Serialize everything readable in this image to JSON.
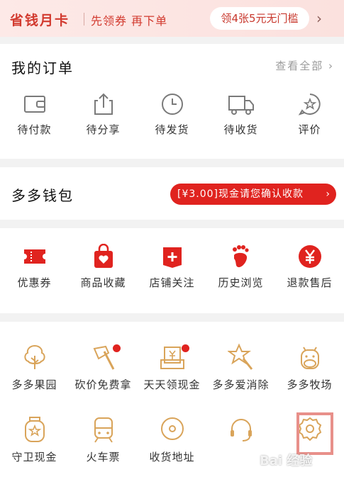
{
  "banner": {
    "title": "省钱月卡",
    "subtitle": "先领券 再下单",
    "pill": "领4张5元无门槛",
    "chevron": "›"
  },
  "orders": {
    "title": "我的订单",
    "view_all": "查看全部 ›",
    "items": [
      {
        "label": "待付款",
        "icon": "wallet-icon"
      },
      {
        "label": "待分享",
        "icon": "share-icon"
      },
      {
        "label": "待发货",
        "icon": "clock-icon"
      },
      {
        "label": "待收货",
        "icon": "truck-icon"
      },
      {
        "label": "评价",
        "icon": "review-icon"
      }
    ]
  },
  "wallet": {
    "title": "多多钱包",
    "notice": "[¥3.00]现金请您确认收款",
    "arrow": "›"
  },
  "services": {
    "items": [
      {
        "label": "优惠券",
        "icon": "coupon-icon"
      },
      {
        "label": "商品收藏",
        "icon": "bag-heart-icon"
      },
      {
        "label": "店铺关注",
        "icon": "store-plus-icon"
      },
      {
        "label": "历史浏览",
        "icon": "footprint-icon"
      },
      {
        "label": "退款售后",
        "icon": "yen-circle-icon"
      }
    ]
  },
  "tools": {
    "items": [
      {
        "label": "多多果园",
        "icon": "tree-icon"
      },
      {
        "label": "砍价免费拿",
        "icon": "axe-icon"
      },
      {
        "label": "天天领现金",
        "icon": "cash-box-icon"
      },
      {
        "label": "多多爱消除",
        "icon": "star-wand-icon"
      },
      {
        "label": "多多牧场",
        "icon": "cow-icon"
      },
      {
        "label": "守卫现金",
        "icon": "cash-jar-icon"
      },
      {
        "label": "火车票",
        "icon": "train-icon"
      },
      {
        "label": "收货地址",
        "icon": "location-icon"
      },
      {
        "label": "",
        "icon": "headset-icon"
      },
      {
        "label": "",
        "icon": "settings-gear-icon"
      }
    ]
  },
  "watermark": "Bai 经验",
  "colors": {
    "accent": "#e0231f",
    "line_icon": "#7a7a7a",
    "gold_icon": "#d9a45a"
  }
}
